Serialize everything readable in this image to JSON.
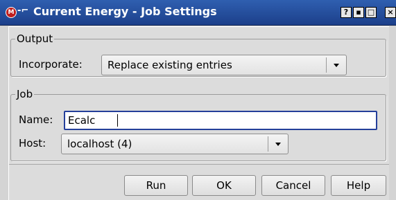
{
  "window": {
    "title": "Current Energy - Job Settings",
    "logo_glyph": "M",
    "pin_glyph": "-⌐",
    "controls": [
      {
        "name": "help",
        "glyph": "?"
      },
      {
        "name": "minimize",
        "glyph": "▪"
      },
      {
        "name": "maximize",
        "glyph": "□"
      },
      {
        "name": "close",
        "glyph": "×"
      }
    ]
  },
  "output": {
    "legend": "Output",
    "incorporate_label": "Incorporate:",
    "incorporate_value": "Replace existing entries"
  },
  "job": {
    "legend": "Job",
    "name_label": "Name:",
    "name_value": "Ecalc",
    "host_label": "Host:",
    "host_value": "localhost (4)"
  },
  "buttons": {
    "run": "Run",
    "ok": "OK",
    "cancel": "Cancel",
    "help": "Help"
  },
  "colors": {
    "titlebar": "#1c3f8a",
    "dialog_bg": "#dcdcdc",
    "focus_border": "#243f9a"
  }
}
